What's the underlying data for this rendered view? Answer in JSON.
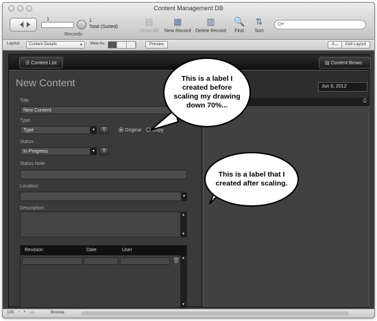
{
  "window": {
    "title": "Content Management DB"
  },
  "toolbar": {
    "slider_value": "1",
    "record_count": "1",
    "record_status": "Total (Sorted)",
    "records_label": "Records",
    "show_all": "Show All",
    "new_record": "New Record",
    "delete_record": "Delete Record",
    "find": "Find",
    "sort": "Sort",
    "search_placeholder": "Q▾"
  },
  "layoutbar": {
    "layout_label": "Layout:",
    "layout_value": "Content Details",
    "view_as_label": "View As:",
    "preview": "Preview",
    "aa": "A↔",
    "edit_layout": "Edit Layout"
  },
  "content": {
    "list_button": "Content List",
    "browse_button": "Content Brows",
    "page_title": "New Content",
    "date": "Jun 6, 2012",
    "fields": {
      "title_label": "Title",
      "title_value": "New Content",
      "type_label": "Type",
      "type_value": "Type",
      "radio_original": "Original",
      "radio_copy": "Copy",
      "status_label": "Status",
      "status_value": "In Progress",
      "status_note_label": "Status Note",
      "location_label": "Location",
      "description_label": "Description"
    },
    "portal": {
      "headers": [
        "Revision",
        "Date",
        "User"
      ]
    }
  },
  "statusbar": {
    "zoom": "100",
    "mode": "Browse"
  },
  "callouts": {
    "first": "This is a label I created before scaling my drawing down 70%...",
    "second": "This is a label that I created after scaling."
  },
  "colors": {
    "panel_dark": "#3a3a3a",
    "toolbar_icon": "#4f6f92"
  }
}
